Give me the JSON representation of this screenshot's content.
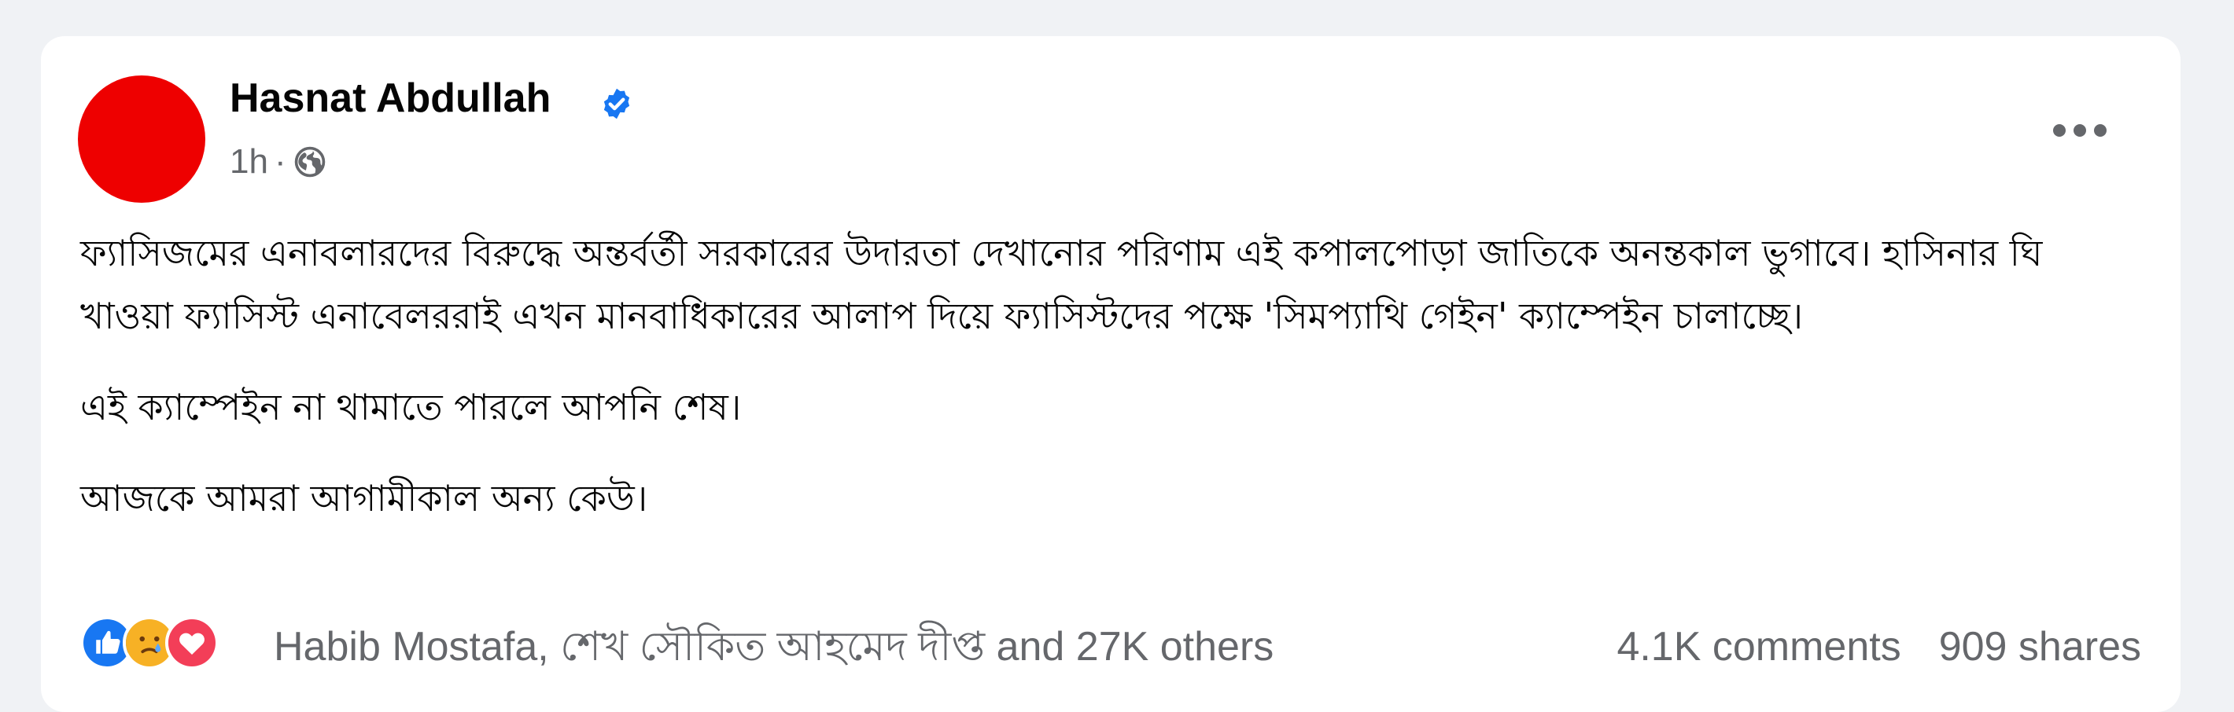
{
  "post": {
    "author_name": "Hasnat Abdullah",
    "time": "1h",
    "separator": "·",
    "audience_icon": "globe-icon",
    "verified_icon": "verified-badge-icon",
    "more_icon": "more-options-icon",
    "paragraphs": [
      "ফ্যাসিজমের এনাবলারদের বিরুদ্ধে অন্তর্বর্তী সরকারের উদারতা দেখানোর পরিণাম এই কপালপোড়া জাতিকে অনন্তকাল ভুগাবে। হাসিনার ঘি খাওয়া ফ্যাসিস্ট এনাবেলররাই এখন মানবাধিকারের আলাপ দিয়ে ফ্যাসিস্টদের পক্ষে 'সিমপ্যাথি গেইন' ক্যাম্পেইন চালাচ্ছে।",
      "এই ক্যাম্পেইন না থামাতে পারলে আপনি শেষ।",
      "আজকে আমরা আগামীকাল অন্য কেউ।"
    ],
    "reactions": {
      "icons": [
        "like-icon",
        "care-icon",
        "love-icon"
      ],
      "summary": "Habib Mostafa, শেখ সৌকিত আহমেদ দীপ্ত and 27K others"
    },
    "comments": "4.1K comments",
    "shares": "909 shares"
  },
  "colors": {
    "background": "#f0f2f5",
    "card": "#ffffff",
    "avatar": "#ee0000",
    "verified": "#1877f2",
    "muted_text": "#65676b",
    "like": "#1877f2",
    "love": "#f33e58",
    "care": "#f7b125"
  }
}
